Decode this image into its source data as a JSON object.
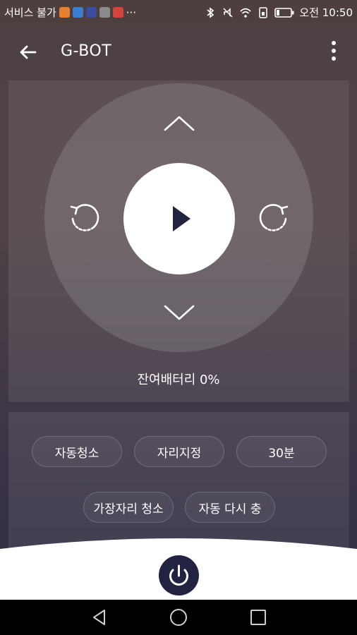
{
  "status_bar": {
    "carrier_text": "서비스 불가",
    "more": "···",
    "time": "오전 10:50",
    "notification_icons": [
      "orange-app-icon",
      "blue-app-icon",
      "navy-app-icon",
      "photo-icon",
      "red-app-icon"
    ],
    "system_icons": [
      "bluetooth-icon",
      "mute-icon",
      "wifi-icon",
      "sim-icon",
      "battery-icon"
    ]
  },
  "app_bar": {
    "title": "G-BOT"
  },
  "control": {
    "battery_text": "잔여배터리 0%"
  },
  "options": {
    "buttons": [
      "자동청소",
      "자리지정",
      "30분",
      "가장자리 청소",
      "자동 다시 충"
    ]
  },
  "colors": {
    "accent_dark": "#222341",
    "panel_bg": "#4e4145",
    "white": "#ffffff"
  }
}
